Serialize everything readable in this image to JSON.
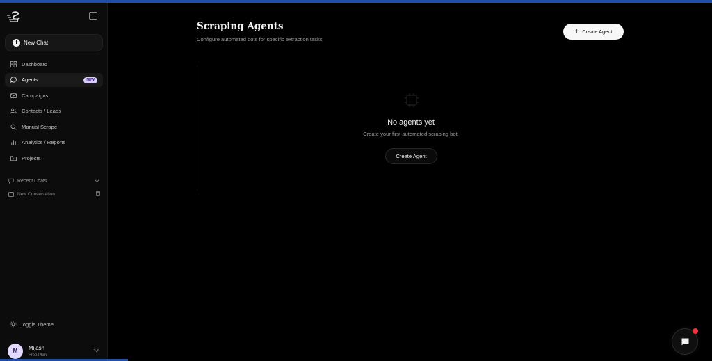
{
  "sidebar": {
    "new_chat_label": "New Chat",
    "items": [
      {
        "label": "Dashboard",
        "icon": "grid-icon"
      },
      {
        "label": "Agents",
        "icon": "chat-bubble-icon",
        "badge": "NEW",
        "active": true
      },
      {
        "label": "Campaigns",
        "icon": "mail-icon"
      },
      {
        "label": "Contacts / Leads",
        "icon": "users-icon"
      },
      {
        "label": "Manual Scrape",
        "icon": "search-icon"
      },
      {
        "label": "Analytics / Reports",
        "icon": "bar-chart-icon"
      },
      {
        "label": "Projects",
        "icon": "folder-icon"
      }
    ],
    "recent_chats_label": "Recent Chats",
    "recent_chats": [
      {
        "label": "New Conversation"
      }
    ],
    "toggle_theme_label": "Toggle Theme",
    "user": {
      "initial": "M",
      "name": "Mijash",
      "plan": "Free Plan"
    }
  },
  "main": {
    "title": "Scraping Agents",
    "subtitle": "Configure automated bots for specific extraction tasks",
    "create_button_label": "Create Agent",
    "empty_state": {
      "title": "No agents yet",
      "description": "Create your first automated scraping bot.",
      "button_label": "Create Agent"
    }
  },
  "colors": {
    "accent_bar": "#1f4fa8",
    "badge_bg": "#d9ccff",
    "notification_dot": "#ef3340"
  }
}
